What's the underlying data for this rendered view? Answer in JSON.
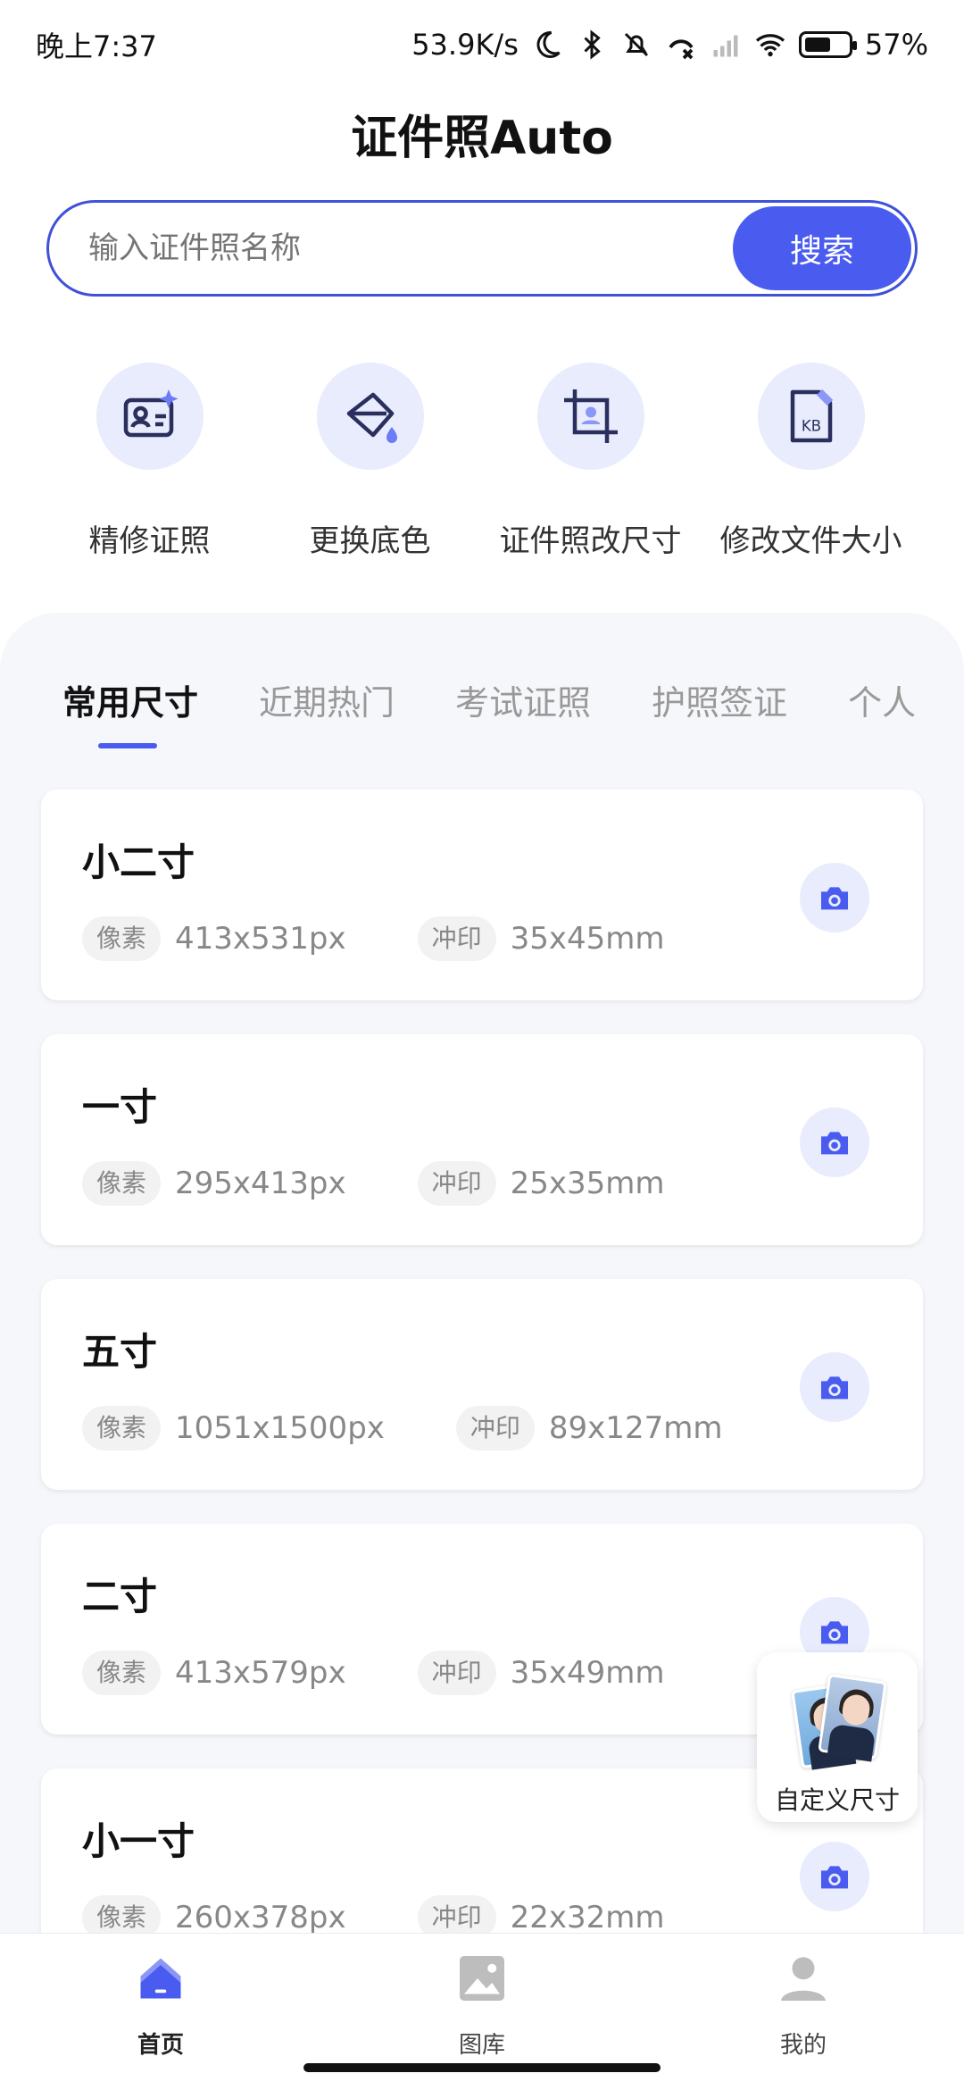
{
  "status_bar": {
    "time": "晚上7:37",
    "net_speed": "53.9K/s",
    "battery": "57%",
    "icons": [
      "moon-icon",
      "bluetooth-icon",
      "mute-icon",
      "call-icon",
      "signal-icon",
      "wifi-icon",
      "battery-icon"
    ]
  },
  "header": {
    "title": "证件照Auto"
  },
  "search": {
    "placeholder": "输入证件照名称",
    "button": "搜索"
  },
  "tools": [
    {
      "label": "精修证照",
      "icon": "id-card-sparkle-icon"
    },
    {
      "label": "更换底色",
      "icon": "paint-bucket-icon"
    },
    {
      "label": "证件照改尺寸",
      "icon": "crop-icon"
    },
    {
      "label": "修改文件大小",
      "icon": "file-kb-icon"
    }
  ],
  "tabs": [
    {
      "label": "常用尺寸",
      "active": true
    },
    {
      "label": "近期热门"
    },
    {
      "label": "考试证照"
    },
    {
      "label": "护照签证"
    },
    {
      "label": "个人"
    }
  ],
  "labels": {
    "pixel": "像素",
    "print": "冲印"
  },
  "sizes": [
    {
      "name": "小二寸",
      "pixels": "413x531px",
      "print": "35x45mm"
    },
    {
      "name": "一寸",
      "pixels": "295x413px",
      "print": "25x35mm"
    },
    {
      "name": "五寸",
      "pixels": "1051x1500px",
      "print": "89x127mm"
    },
    {
      "name": "二寸",
      "pixels": "413x579px",
      "print": "35x49mm"
    },
    {
      "name": "小一寸",
      "pixels": "260x378px",
      "print": "22x32mm"
    }
  ],
  "float_custom": {
    "label": "自定义尺寸"
  },
  "bottom_nav": [
    {
      "label": "首页",
      "icon": "home-icon",
      "active": true
    },
    {
      "label": "图库",
      "icon": "gallery-icon"
    },
    {
      "label": "我的",
      "icon": "profile-icon"
    }
  ],
  "colors": {
    "accent": "#4a5cf0",
    "accent_light": "#e8ecfd",
    "panel_bg": "#f6f7fb"
  }
}
